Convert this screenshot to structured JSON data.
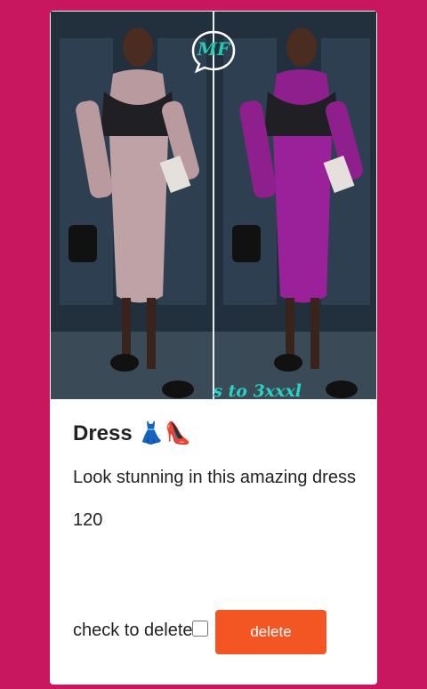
{
  "card": {
    "logo_text": "MF",
    "size_text": "s to 3xxxl",
    "title": "Dress 👗👠",
    "description": "Look stunning in this amazing dress",
    "price": "120",
    "delete_checkbox_label": "check to delete",
    "delete_button_label": "delete"
  },
  "colors": {
    "page_background": "#c8175f",
    "card_background": "#ffffff",
    "delete_button": "#f35523"
  }
}
